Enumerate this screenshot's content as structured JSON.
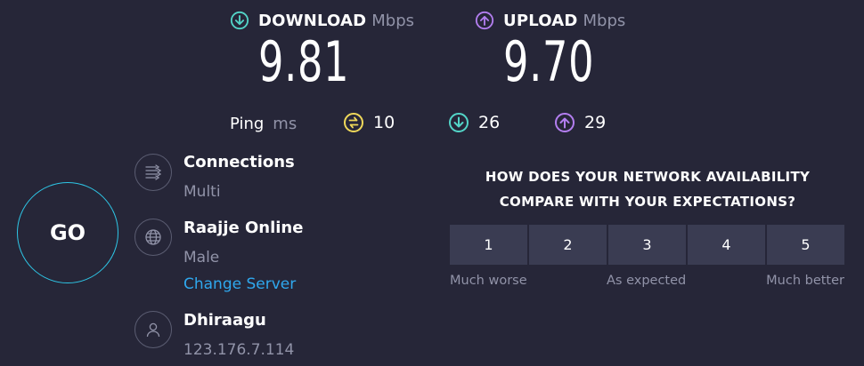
{
  "download": {
    "label": "DOWNLOAD",
    "unit": "Mbps",
    "value": "9.81",
    "color": "#53d5c8"
  },
  "upload": {
    "label": "UPLOAD",
    "unit": "Mbps",
    "value": "9.70",
    "color": "#b37ef0"
  },
  "ping": {
    "label": "Ping",
    "unit": "ms",
    "idle": "10",
    "download": "26",
    "upload": "29",
    "idle_color": "#f0d95a"
  },
  "go_label": "GO",
  "connections": {
    "title": "Connections",
    "value": "Multi"
  },
  "server": {
    "name": "Raajje Online",
    "location": "Male",
    "change_label": "Change Server"
  },
  "provider": {
    "name": "Dhiraagu",
    "ip": "123.176.7.114"
  },
  "survey": {
    "question_line1": "HOW DOES YOUR NETWORK AVAILABILITY",
    "question_line2": "COMPARE WITH YOUR EXPECTATIONS?",
    "options": [
      "1",
      "2",
      "3",
      "4",
      "5"
    ],
    "low_label": "Much worse",
    "mid_label": "As expected",
    "high_label": "Much better"
  },
  "colors": {
    "background": "#262638",
    "go_ring": "#2ec6e6",
    "link": "#2fa8ee",
    "muted": "#9193a8"
  }
}
